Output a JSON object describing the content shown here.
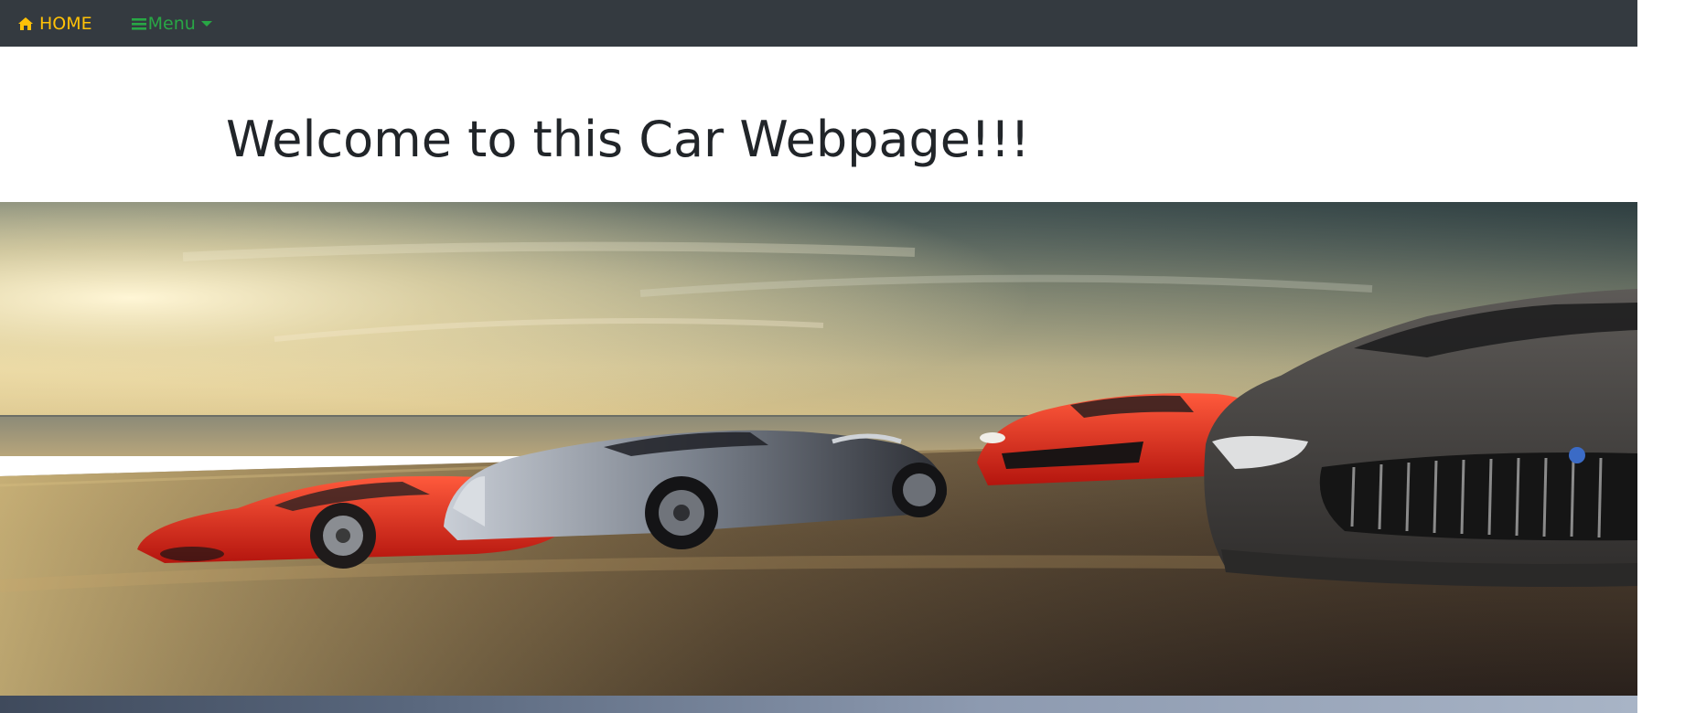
{
  "navbar": {
    "home_label": "HOME",
    "menu_label": "Menu",
    "home_icon": "home-icon",
    "menu_icon": "bars-icon",
    "caret_icon": "caret-down-icon",
    "background_color": "#343a40",
    "home_color": "#ffc107",
    "menu_color": "#28a745"
  },
  "main": {
    "heading": "Welcome to this Car Webpage!!!"
  },
  "hero": {
    "image_subject": "sports-cars-on-road-at-sunset"
  }
}
